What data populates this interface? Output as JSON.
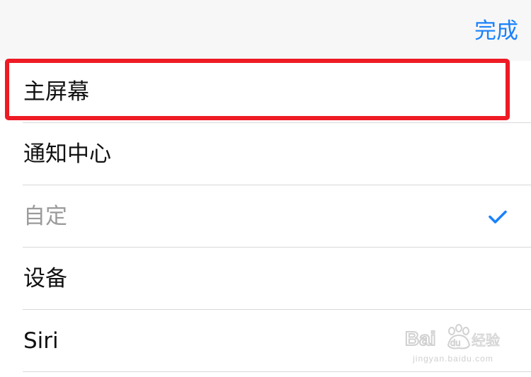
{
  "nav": {
    "done_label": "完成"
  },
  "menu": {
    "items": [
      {
        "label": "主屏幕",
        "disabled": false,
        "checked": false,
        "highlighted": true
      },
      {
        "label": "通知中心",
        "disabled": false,
        "checked": false,
        "highlighted": false
      },
      {
        "label": "自定",
        "disabled": true,
        "checked": true,
        "highlighted": false
      },
      {
        "label": "设备",
        "disabled": false,
        "checked": false,
        "highlighted": false
      },
      {
        "label": "Siri",
        "disabled": false,
        "checked": false,
        "highlighted": false
      }
    ]
  },
  "watermark": {
    "brand": "Bai du 经验",
    "url": "jingyan.baidu.com"
  },
  "colors": {
    "accent": "#1a82fb",
    "highlight": "#ee1b24",
    "separator": "#d9d9dc",
    "disabled_text": "#9b9b9b"
  },
  "icons": {
    "check": "checkmark-icon"
  }
}
